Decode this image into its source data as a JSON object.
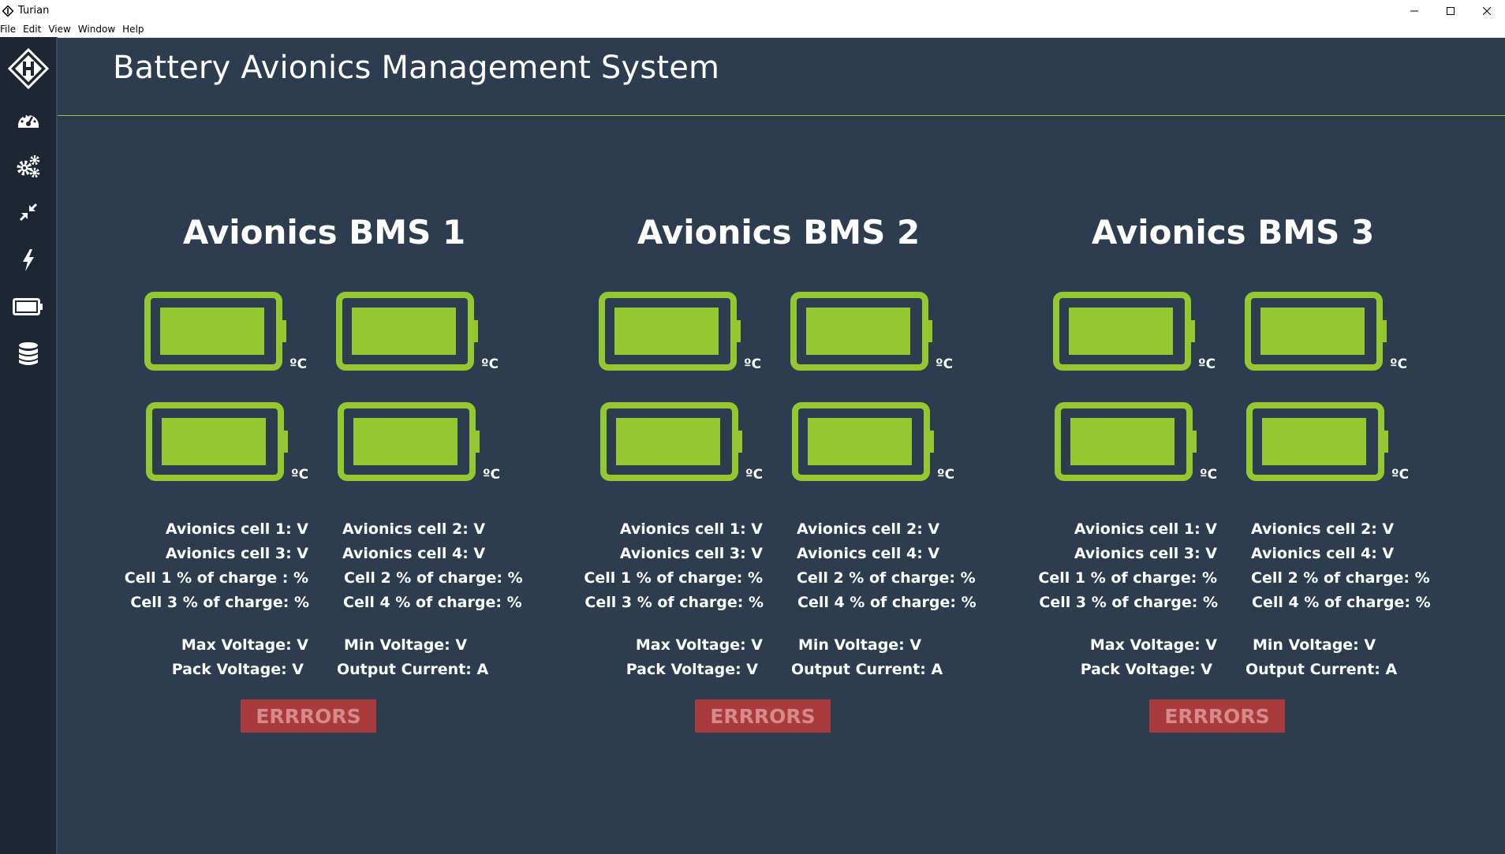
{
  "window": {
    "title": "Turian"
  },
  "menu": [
    "File",
    "Edit",
    "View",
    "Window",
    "Help"
  ],
  "sidebar": {
    "icons": [
      "logo-icon",
      "dashboard-icon",
      "settings-icon",
      "compress-icon",
      "lightning-icon",
      "battery-icon",
      "database-icon"
    ]
  },
  "header": {
    "title": "Battery Avionics Management System"
  },
  "colors": {
    "battery": "#94c830",
    "background": "#2e3c4f",
    "sidebar": "#1d2632",
    "errors": "#a93b3c"
  },
  "bms": [
    {
      "title": "Avionics BMS 1",
      "temp_unit": "ºC",
      "cell1_v": "Avionics cell 1: V",
      "cell2_v": "Avionics cell 2: V",
      "cell3_v": "Avionics cell 3: V",
      "cell4_v": "Avionics cell 4: V",
      "cell1_soc": "Cell 1 % of charge : %",
      "cell2_soc": "Cell 2 % of charge: %",
      "cell3_soc": "Cell 3 % of charge: %",
      "cell4_soc": "Cell 4 % of charge: %",
      "max_v": "Max Voltage: V",
      "min_v": "Min Voltage: V",
      "pack_v": "Pack Voltage: V",
      "output_i": "Output Current: A",
      "errors": "ERRRORS"
    },
    {
      "title": "Avionics BMS 2",
      "temp_unit": "ºC",
      "cell1_v": "Avionics cell 1: V",
      "cell2_v": "Avionics cell 2: V",
      "cell3_v": "Avionics cell 3: V",
      "cell4_v": "Avionics cell 4: V",
      "cell1_soc": "Cell 1 % of charge: %",
      "cell2_soc": "Cell 2 % of charge: %",
      "cell3_soc": "Cell 3 % of charge: %",
      "cell4_soc": "Cell 4 % of charge: %",
      "max_v": "Max Voltage: V",
      "min_v": "Min Voltage: V",
      "pack_v": "Pack Voltage: V",
      "output_i": "Output Current: A",
      "errors": "ERRRORS"
    },
    {
      "title": "Avionics BMS 3",
      "temp_unit": "ºC",
      "cell1_v": "Avionics cell 1: V",
      "cell2_v": "Avionics cell 2: V",
      "cell3_v": "Avionics cell 3: V",
      "cell4_v": "Avionics cell 4: V",
      "cell1_soc": "Cell 1 % of charge: %",
      "cell2_soc": "Cell 2 % of charge: %",
      "cell3_soc": "Cell 3 % of charge: %",
      "cell4_soc": "Cell 4 % of charge: %",
      "max_v": "Max Voltage: V",
      "min_v": "Min Voltage: V",
      "pack_v": "Pack Voltage: V",
      "output_i": "Output Current: A",
      "errors": "ERRRORS"
    }
  ]
}
